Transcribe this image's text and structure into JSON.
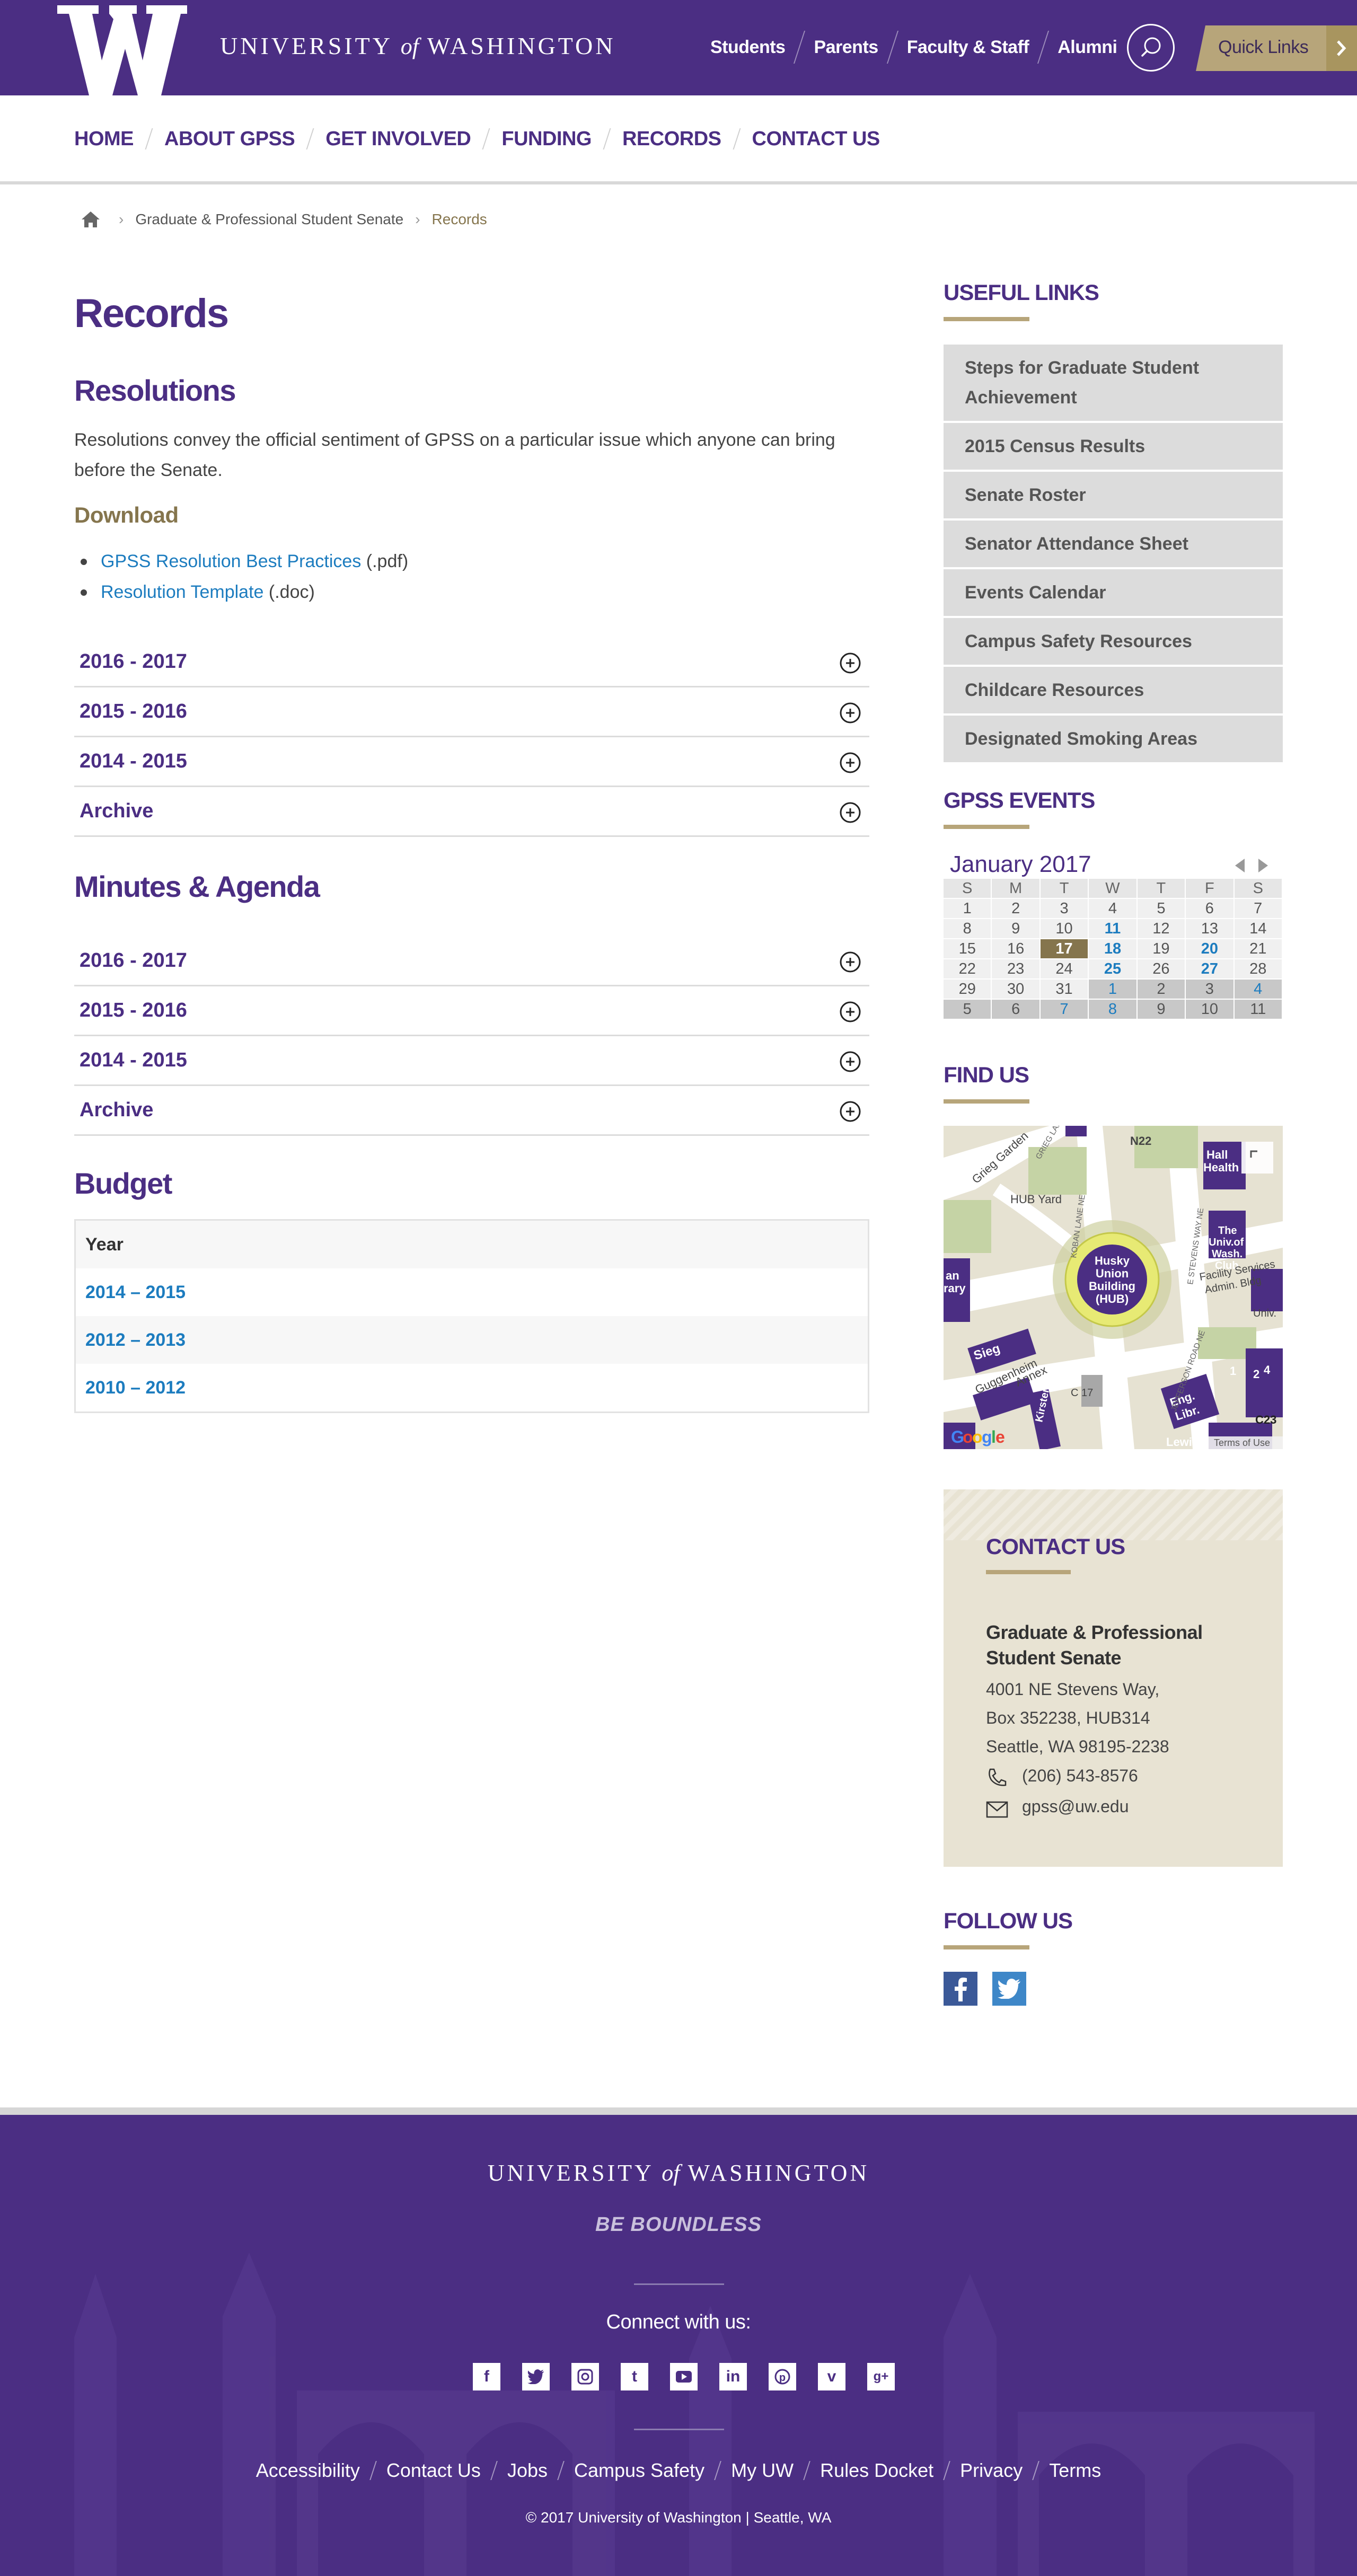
{
  "header": {
    "logo_letter": "W",
    "university_pre": "UNIVERSITY",
    "university_of": "of",
    "university_post": "WASHINGTON",
    "audience_links": [
      "Students",
      "Parents",
      "Faculty & Staff",
      "Alumni"
    ],
    "quick_links_label": "Quick Links",
    "search_icon": "search-icon"
  },
  "nav": {
    "items": [
      "HOME",
      "ABOUT GPSS",
      "GET INVOLVED",
      "FUNDING",
      "RECORDS",
      "CONTACT US"
    ]
  },
  "breadcrumb": {
    "home_icon": "home-icon",
    "items": [
      "Graduate & Professional Student Senate",
      "Records"
    ]
  },
  "main": {
    "title": "Records",
    "resolutions": {
      "heading": "Resolutions",
      "intro": "Resolutions convey the official sentiment of GPSS on a particular issue which anyone can bring before the Senate.",
      "download_heading": "Download",
      "downloads": [
        {
          "label": "GPSS Resolution Best Practices",
          "ext": "(.pdf)"
        },
        {
          "label": "Resolution Template",
          "ext": "(.doc)"
        }
      ],
      "accordion": [
        "2016 - 2017",
        "2015 - 2016",
        "2014 - 2015",
        "Archive"
      ]
    },
    "minutes": {
      "heading": "Minutes & Agenda",
      "accordion": [
        "2016 - 2017",
        "2015 - 2016",
        "2014 - 2015",
        "Archive"
      ]
    },
    "budget": {
      "heading": "Budget",
      "column_header": "Year",
      "rows": [
        "2014 – 2015",
        "2012 – 2013",
        "2010 – 2012"
      ]
    }
  },
  "sidebar": {
    "useful_links": {
      "heading": "USEFUL LINKS",
      "items": [
        "Steps for Graduate Student Achievement",
        "2015 Census Results",
        "Senate Roster",
        "Senator Attendance Sheet",
        "Events Calendar",
        "Campus Safety Resources",
        "Childcare Resources",
        "Designated Smoking Areas"
      ]
    },
    "events": {
      "heading": "GPSS EVENTS",
      "month": "January 2017",
      "weekdays": [
        "S",
        "M",
        "T",
        "W",
        "T",
        "F",
        "S"
      ],
      "weeks": [
        [
          "1",
          "2",
          "3",
          "4",
          "5",
          "6",
          "7"
        ],
        [
          "8",
          "9",
          "10",
          "11",
          "12",
          "13",
          "14"
        ],
        [
          "15",
          "16",
          "17",
          "18",
          "19",
          "20",
          "21"
        ],
        [
          "22",
          "23",
          "24",
          "25",
          "26",
          "27",
          "28"
        ],
        [
          "29",
          "30",
          "31",
          "1",
          "2",
          "3",
          "4"
        ],
        [
          "5",
          "6",
          "7",
          "8",
          "9",
          "10",
          "11"
        ]
      ],
      "event_days": [
        "11",
        "18",
        "20",
        "25",
        "27"
      ],
      "today": "17",
      "colors": {
        "today": "#85754d",
        "event": "#1c7cbf"
      }
    },
    "find_us": {
      "heading": "FIND US",
      "map_labels": [
        "Grieg Garden",
        "HUB Yard",
        "N22",
        "Hall Health",
        "The Univ. of Wash. Club",
        "Facility Services Admin. Bldg",
        "Univ.",
        "Husky Union Building (HUB)",
        "Sieg",
        "Guggenheim Annex",
        "Eng. Libr.",
        "Kirsten",
        "C23",
        "C 17",
        "Lewis",
        "an rary",
        "E STEVENS WAY NE",
        "JEFFERSON ROAD NE",
        "KOBAN LANE NE",
        "GRIEG LANE NE",
        "Terms of Use"
      ],
      "map_provider": "Google"
    },
    "contact": {
      "heading": "CONTACT US",
      "org": "Graduate & Professional Student Senate",
      "address_lines": [
        "4001 NE Stevens Way,",
        "Box 352238, HUB314",
        "Seattle, WA 98195-2238"
      ],
      "phone": "(206) 543-8576",
      "email": "gpss@uw.edu"
    },
    "follow": {
      "heading": "FOLLOW US",
      "networks": [
        "facebook-icon",
        "twitter-icon"
      ]
    }
  },
  "footer": {
    "university_pre": "UNIVERSITY",
    "university_of": "of",
    "university_post": "WASHINGTON",
    "tagline": "BE BOUNDLESS",
    "connect": "Connect with us:",
    "social_icons": [
      "facebook-icon",
      "twitter-icon",
      "instagram-icon",
      "tumblr-icon",
      "youtube-icon",
      "linkedin-icon",
      "pinterest-icon",
      "vine-icon",
      "google-plus-icon"
    ],
    "links": [
      "Accessibility",
      "Contact Us",
      "Jobs",
      "Campus Safety",
      "My UW",
      "Rules Docket",
      "Privacy",
      "Terms"
    ],
    "copyright": "© 2017 University of Washington | Seattle, WA"
  },
  "colors": {
    "brand_purple": "#4b2e83",
    "gold": "#85754d",
    "link_blue": "#1c7cbf",
    "quick_links_gold": "#b7a57a"
  }
}
